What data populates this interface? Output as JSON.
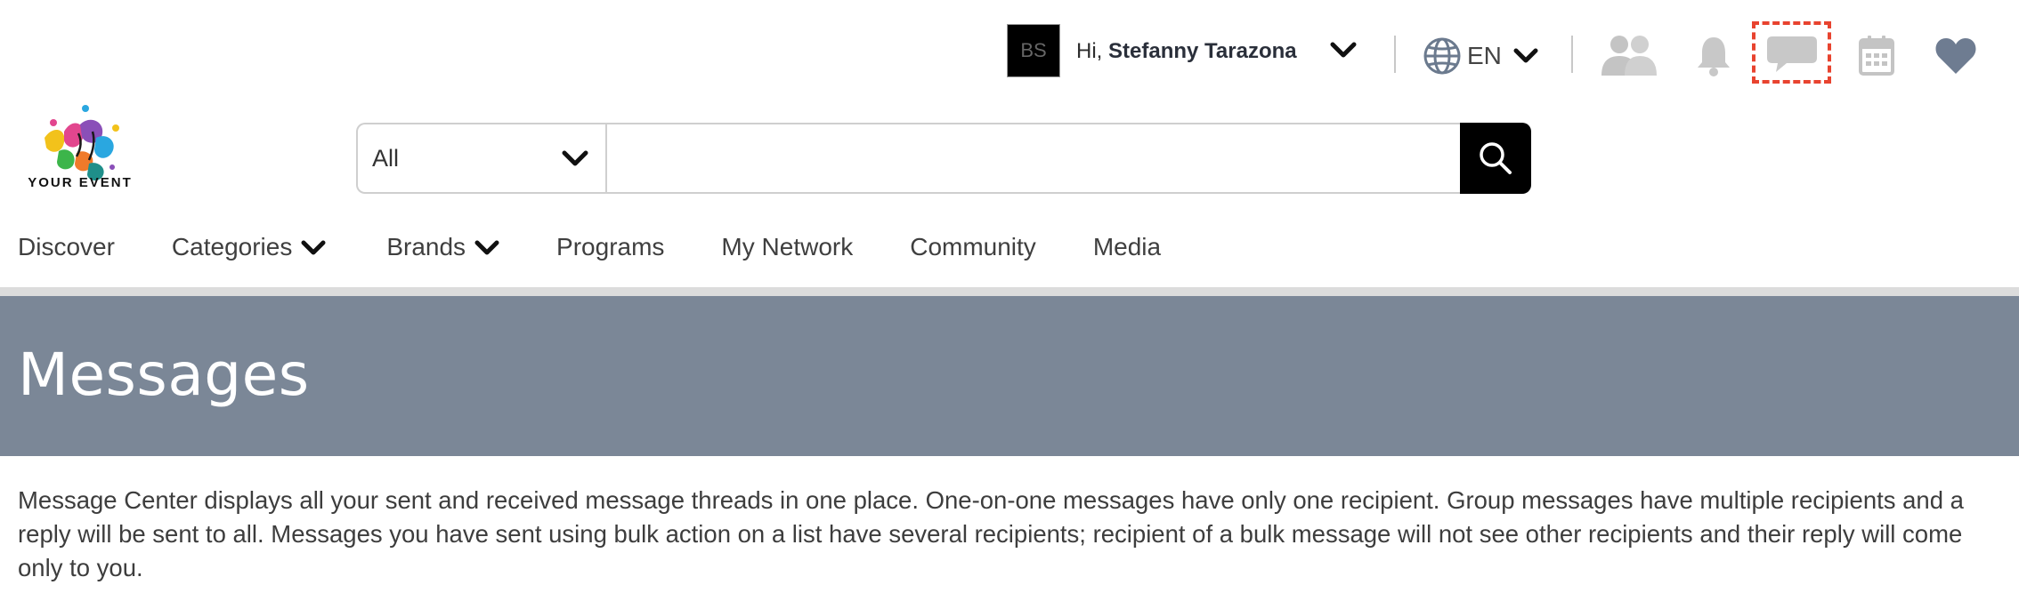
{
  "header": {
    "user": {
      "avatar_initials": "BS",
      "greeting_prefix": "Hi,",
      "name": "Stefanny Tarazona"
    },
    "language": {
      "code": "EN",
      "icon": "globe-icon"
    },
    "icons": [
      "people-icon",
      "bell-icon",
      "chat-bubble-icon",
      "calendar-icon",
      "heart-icon"
    ],
    "highlight_color": "#e8432f"
  },
  "logo": {
    "text": "YOUR EVENT"
  },
  "search": {
    "category_selected": "All",
    "placeholder": "",
    "value": "",
    "button_icon": "search-icon"
  },
  "nav": {
    "items": [
      {
        "label": "Discover",
        "has_dropdown": false
      },
      {
        "label": "Categories",
        "has_dropdown": true
      },
      {
        "label": "Brands",
        "has_dropdown": true
      },
      {
        "label": "Programs",
        "has_dropdown": false
      },
      {
        "label": "My Network",
        "has_dropdown": false
      },
      {
        "label": "Community",
        "has_dropdown": false
      },
      {
        "label": "Media",
        "has_dropdown": false
      }
    ]
  },
  "banner": {
    "title": "Messages",
    "background": "#7b8797"
  },
  "description": "Message Center displays all your sent and received message threads in one place. One-on-one messages have only one recipient. Group messages have multiple recipients and a reply will be sent to all. Messages you have sent using bulk action on a list have several recipients; recipient of a bulk message will not see other recipients and their reply will come only to you."
}
